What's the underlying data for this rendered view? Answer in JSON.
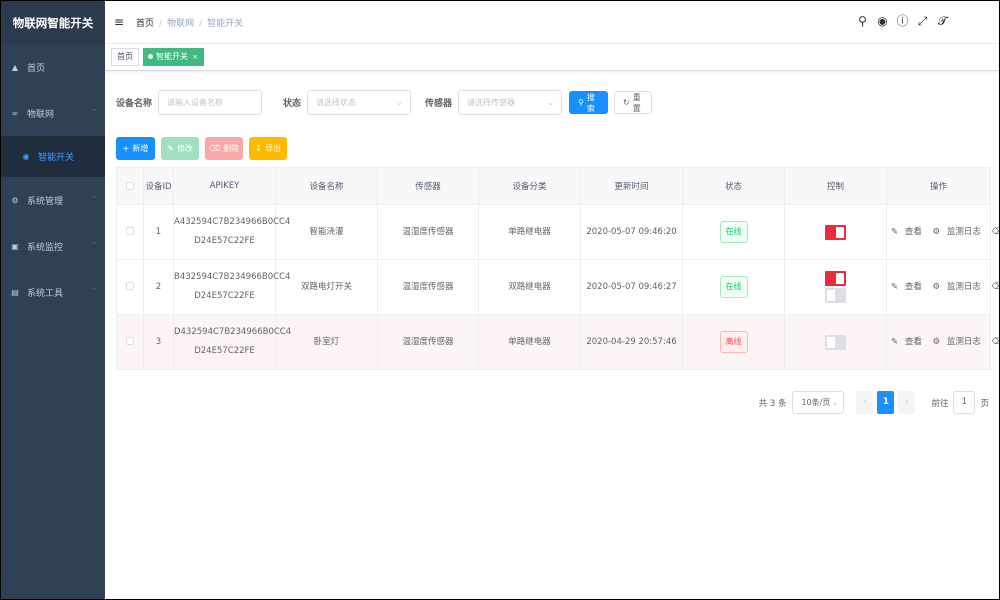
{
  "app": {
    "title": "物联网智能开关"
  },
  "sidebar": {
    "items": [
      {
        "label": "首页",
        "icon": "dashboard-icon"
      },
      {
        "label": "物联网",
        "icon": "link-icon",
        "expanded": true,
        "children": [
          {
            "label": "智能开关",
            "icon": "dot-icon",
            "active": true
          }
        ]
      },
      {
        "label": "系统管理",
        "icon": "gear-icon"
      },
      {
        "label": "系统监控",
        "icon": "monitor-icon"
      },
      {
        "label": "系统工具",
        "icon": "toolbox-icon"
      }
    ]
  },
  "header": {
    "breadcrumb": [
      "首页",
      "物联网",
      "智能开关"
    ],
    "icons": [
      "search-icon",
      "github-icon",
      "question-icon",
      "fullscreen-icon",
      "font-size-icon"
    ]
  },
  "tags": [
    {
      "label": "首页"
    },
    {
      "label": "智能开关",
      "active": true
    }
  ],
  "search": {
    "name_label": "设备名称",
    "name_placeholder": "请输入设备名称",
    "status_label": "状态",
    "status_placeholder": "请选择状态",
    "sensor_label": "传感器",
    "sensor_placeholder": "请选择传感器",
    "search_button": "搜索",
    "reset_button": "重置"
  },
  "toolbar": {
    "add": "新增",
    "edit": "修改",
    "delete": "删除",
    "export": "导出"
  },
  "table": {
    "headers": [
      "设备ID",
      "APIKEY",
      "设备名称",
      "传感器",
      "设备分类",
      "更新时间",
      "状态",
      "控制",
      "操作"
    ],
    "rows": [
      {
        "id": "1",
        "key1": "A432594C7B234966B0CC4",
        "key2": "D24E57C22FE",
        "name": "智能浇灌",
        "sensor": "温湿度传感器",
        "category": "单路继电器",
        "time": "2020-05-07 09:46:20",
        "status": "在线",
        "switches": [
          "on"
        ]
      },
      {
        "id": "2",
        "key1": "B432594C7B234966B0CC4",
        "key2": "D24E57C22FE",
        "name": "双路电灯开关",
        "sensor": "温湿度传感器",
        "category": "双路继电器",
        "time": "2020-05-07 09:46:27",
        "status": "在线",
        "switches": [
          "on",
          "off"
        ]
      },
      {
        "id": "3",
        "key1": "D432594C7B234966B0CC4",
        "key2": "D24E57C22FE",
        "name": "卧室灯",
        "sensor": "温湿度传感器",
        "category": "单路继电器",
        "time": "2020-04-29 20:57:46",
        "status": "离线",
        "switches": [
          "off"
        ]
      }
    ],
    "ops": [
      "查看",
      "监测日志",
      "删除"
    ]
  },
  "pagination": {
    "total": "共 3 条",
    "page_size": "10条/页",
    "current": "1",
    "goto_label": "前往",
    "goto_value": "1",
    "page_suffix": "页"
  },
  "colors": {
    "sidebar_bg": "#304156",
    "primary": "#1890ff",
    "success": "#42b983",
    "danger": "#ee2b3a"
  }
}
